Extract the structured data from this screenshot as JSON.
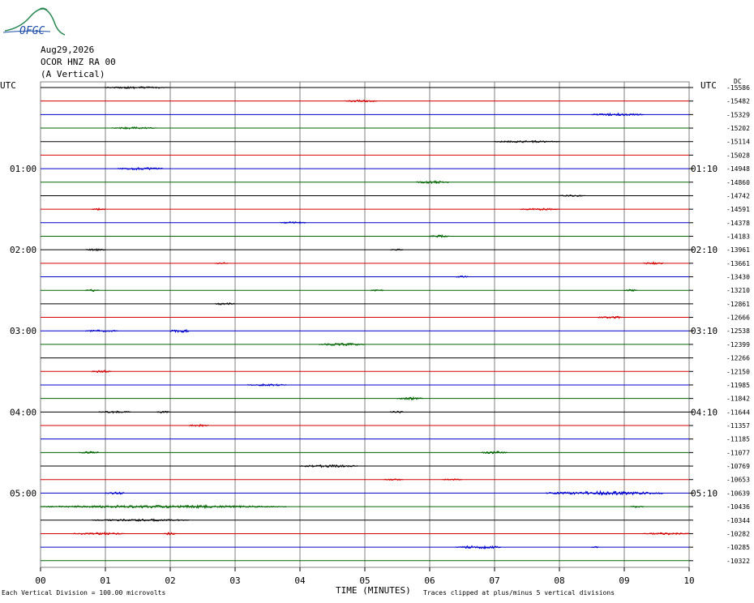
{
  "logo": {
    "text": "OFGC"
  },
  "header": {
    "date": "Aug29,2026",
    "station": "OCOR HNZ RA 00",
    "component": "(A Vertical)"
  },
  "utc_left": "UTC",
  "utc_right": "UTC",
  "dc_label": "DC",
  "colors": {
    "black": "#000000",
    "red": "#d40000",
    "blue": "#0000cc",
    "green": "#006600",
    "grid": "#808080"
  },
  "chart_data": {
    "type": "line",
    "xlabel": "TIME (MINUTES)",
    "xticks": [
      "00",
      "01",
      "02",
      "03",
      "04",
      "05",
      "06",
      "07",
      "08",
      "09",
      "10"
    ],
    "xlim": [
      0,
      10
    ],
    "trace_colors_cycle": [
      "black",
      "red",
      "blue",
      "green"
    ],
    "left_time_labels": [
      {
        "trace": 6,
        "label": "01:00"
      },
      {
        "trace": 12,
        "label": "02:00"
      },
      {
        "trace": 18,
        "label": "03:00"
      },
      {
        "trace": 24,
        "label": "04:00"
      },
      {
        "trace": 30,
        "label": "05:00"
      }
    ],
    "right_time_labels": [
      {
        "trace": 6,
        "label": "01:10"
      },
      {
        "trace": 12,
        "label": "02:10"
      },
      {
        "trace": 18,
        "label": "03:10"
      },
      {
        "trace": 24,
        "label": "04:10"
      },
      {
        "trace": 30,
        "label": "05:10"
      }
    ],
    "dc_offsets": [
      "-15586",
      "-15482",
      "-15329",
      "-15202",
      "-15114",
      "-15028",
      "-14948",
      "-14860",
      "-14742",
      "-14591",
      "-14378",
      "-14183",
      "-13961",
      "-13661",
      "-13430",
      "-13210",
      "-12861",
      "-12666",
      "-12538",
      "-12399",
      "-12266",
      "-12150",
      "-11985",
      "-11842",
      "-11644",
      "-11357",
      "-11185",
      "-11077",
      "-10769",
      "-10653",
      "-10639",
      "-10436",
      "-10344",
      "-10282",
      "-10285",
      "-10322"
    ],
    "bursts": [
      [
        0,
        1.0,
        2.0,
        1.2
      ],
      [
        1,
        4.7,
        5.2,
        1.2
      ],
      [
        2,
        8.5,
        9.3,
        1.5
      ],
      [
        3,
        1.1,
        1.8,
        1.2
      ],
      [
        4,
        7.0,
        8.0,
        1.2
      ],
      [
        6,
        1.2,
        1.9,
        1.5
      ],
      [
        7,
        5.8,
        6.3,
        1.5
      ],
      [
        8,
        8.0,
        8.4,
        1.0
      ],
      [
        9,
        0.8,
        1.0,
        1.2
      ],
      [
        9,
        7.4,
        8.0,
        1.2
      ],
      [
        10,
        3.7,
        4.1,
        1.2
      ],
      [
        11,
        6.0,
        6.3,
        1.5
      ],
      [
        12,
        0.7,
        1.0,
        1.2
      ],
      [
        12,
        5.4,
        5.6,
        1.0
      ],
      [
        13,
        2.7,
        2.9,
        1.2
      ],
      [
        13,
        9.3,
        9.6,
        1.5
      ],
      [
        14,
        6.4,
        6.6,
        1.2
      ],
      [
        15,
        0.7,
        0.9,
        1.5
      ],
      [
        15,
        5.1,
        5.3,
        1.0
      ],
      [
        15,
        9.0,
        9.2,
        1.2
      ],
      [
        16,
        2.7,
        3.0,
        1.5
      ],
      [
        17,
        8.6,
        9.0,
        1.5
      ],
      [
        18,
        0.7,
        1.2,
        1.2
      ],
      [
        18,
        2.0,
        2.3,
        2.0
      ],
      [
        19,
        4.3,
        5.0,
        1.5
      ],
      [
        21,
        0.8,
        1.1,
        1.5
      ],
      [
        22,
        3.2,
        3.8,
        1.2
      ],
      [
        23,
        5.5,
        5.9,
        1.5
      ],
      [
        24,
        0.9,
        1.4,
        1.2
      ],
      [
        24,
        1.8,
        2.0,
        1.0
      ],
      [
        24,
        5.4,
        5.6,
        1.2
      ],
      [
        25,
        2.3,
        2.6,
        1.5
      ],
      [
        27,
        0.6,
        0.9,
        1.5
      ],
      [
        27,
        6.8,
        7.2,
        1.5
      ],
      [
        28,
        4.0,
        4.9,
        1.5
      ],
      [
        29,
        5.3,
        5.6,
        1.0
      ],
      [
        29,
        6.2,
        6.5,
        1.0
      ],
      [
        30,
        1.0,
        1.3,
        1.5
      ],
      [
        30,
        7.8,
        9.6,
        2.2
      ],
      [
        31,
        0.0,
        3.8,
        1.6
      ],
      [
        31,
        9.1,
        9.3,
        1.2
      ],
      [
        32,
        0.8,
        2.3,
        1.2
      ],
      [
        33,
        0.5,
        1.3,
        1.5
      ],
      [
        33,
        1.9,
        2.1,
        1.5
      ],
      [
        33,
        9.3,
        10.0,
        1.2
      ],
      [
        34,
        6.4,
        7.1,
        2.0
      ],
      [
        34,
        8.5,
        8.6,
        1.0
      ]
    ],
    "footer_left": "Each Vertical Division =  100.00 microvolts",
    "footer_right": "Traces clipped at plus/minus 5 vertical divisions"
  }
}
